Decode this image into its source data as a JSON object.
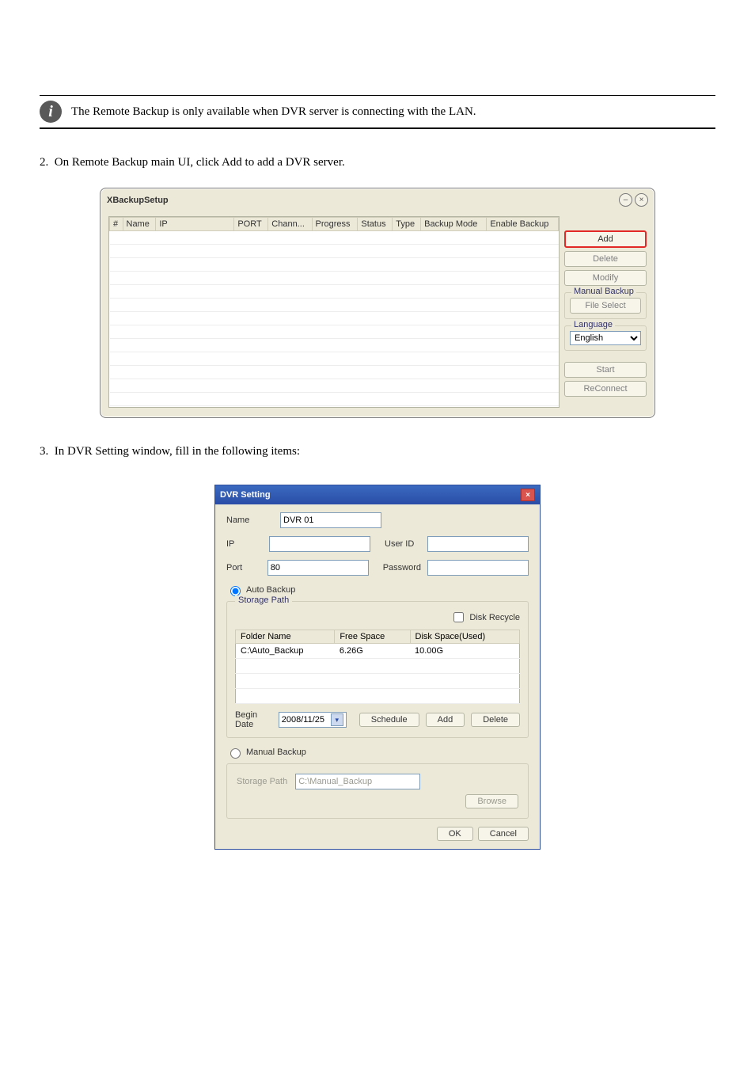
{
  "info_note": "The Remote Backup is only available when DVR server is connecting with the LAN.",
  "step2": "On Remote Backup main UI, click Add to add a DVR server.",
  "xbackup": {
    "title": "XBackupSetup",
    "columns": [
      "#",
      "Name",
      "IP",
      "PORT",
      "Chann...",
      "Progress",
      "Status",
      "Type",
      "Backup Mode",
      "Enable Backup"
    ],
    "buttons": {
      "add": "Add",
      "delete": "Delete",
      "modify": "Modify"
    },
    "groups": {
      "manual": "Manual Backup",
      "file_select": "File Select",
      "language": "Language"
    },
    "language_value": "English",
    "start": "Start",
    "reconnect": "ReConnect"
  },
  "dvr": {
    "title": "DVR Setting",
    "labels": {
      "name": "Name",
      "ip": "IP",
      "port": "Port",
      "userid": "User ID",
      "password": "Password",
      "auto": "Auto Backup",
      "storage": "Storage Path",
      "disk_recycle": "Disk Recycle",
      "folder": "Folder Name",
      "free": "Free Space",
      "used": "Disk Space(Used)",
      "begin": "Begin Date",
      "schedule": "Schedule",
      "add": "Add",
      "delete": "Delete",
      "manual": "Manual Backup",
      "storage2": "Storage Path",
      "browse": "Browse",
      "ok": "OK",
      "cancel": "Cancel"
    },
    "values": {
      "name": "DVR 01",
      "ip": "",
      "port": "80",
      "userid": "",
      "password": "",
      "begin": "2008/11/25",
      "manual_path": "C:\\Manual_Backup"
    },
    "row": {
      "folder": "C:\\Auto_Backup",
      "free": "6.26G",
      "used": "10.00G"
    }
  },
  "step3": "In DVR Setting window, fill in the following items:"
}
